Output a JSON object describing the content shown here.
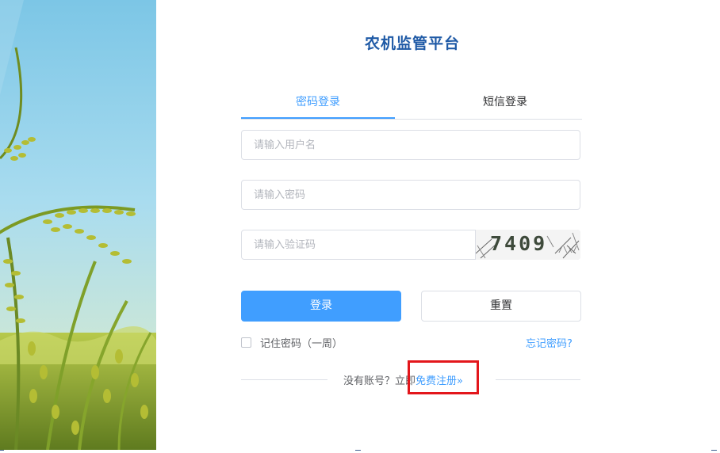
{
  "app": {
    "title": "农机监管平台"
  },
  "tabs": [
    {
      "label": "密码登录",
      "active": true
    },
    {
      "label": "短信登录",
      "active": false
    }
  ],
  "form": {
    "username_placeholder": "请输入用户名",
    "password_placeholder": "请输入密码",
    "captcha_placeholder": "请输入验证码",
    "captcha_code": "7409"
  },
  "buttons": {
    "login": "登录",
    "reset": "重置"
  },
  "options": {
    "remember": "记住密码（一周）",
    "forgot": "忘记密码?"
  },
  "register": {
    "prompt": "没有账号？立即",
    "link": "免费注册",
    "chevron": "»"
  },
  "colors": {
    "accent": "#409eff",
    "title": "#1f5aa6",
    "highlight": "#e3161b"
  },
  "icons": {
    "hero": "rice-field-image",
    "chevron": "double-chevron-right-icon"
  }
}
